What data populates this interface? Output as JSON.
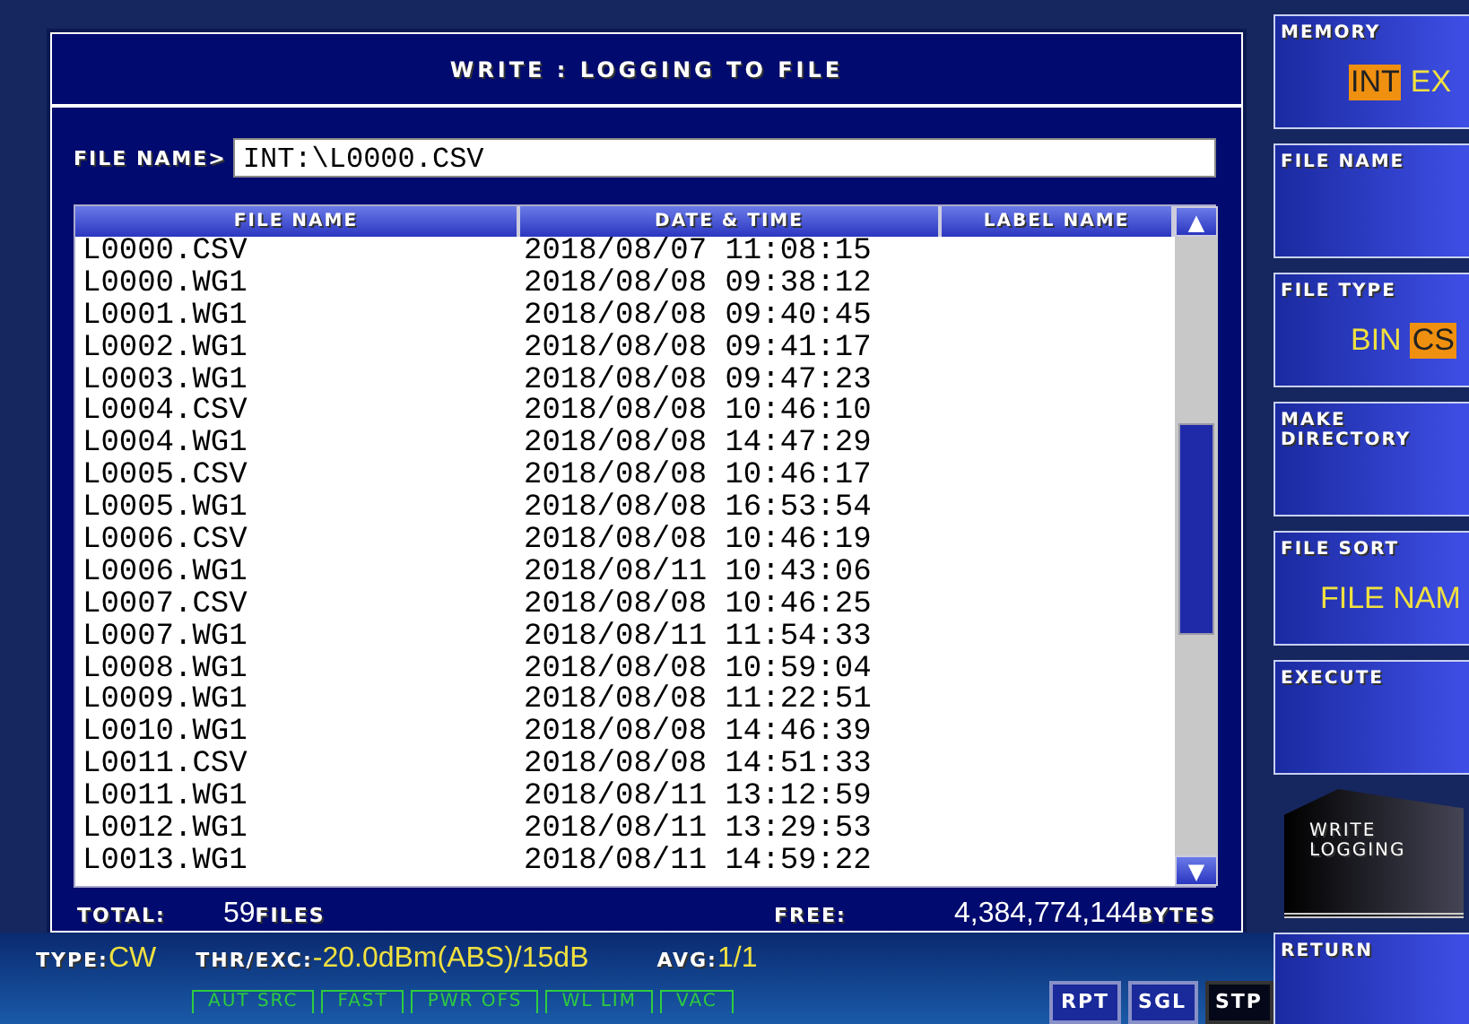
{
  "dialog": {
    "title": "WRITE : LOGGING TO FILE",
    "file_name_label": "FILE NAME>",
    "file_name_value": "INT:\\L0000.CSV",
    "table": {
      "columns": [
        "FILE NAME",
        "DATE & TIME",
        "LABEL NAME"
      ],
      "scroll_up": "▲",
      "scroll_down": "▼",
      "rows": [
        {
          "file_name": "L0000.CSV",
          "date_time": "2018/08/07 11:08:15"
        },
        {
          "file_name": "L0000.WG1",
          "date_time": "2018/08/08 09:38:12"
        },
        {
          "file_name": "L0001.WG1",
          "date_time": "2018/08/08 09:40:45"
        },
        {
          "file_name": "L0002.WG1",
          "date_time": "2018/08/08 09:41:17"
        },
        {
          "file_name": "L0003.WG1",
          "date_time": "2018/08/08 09:47:23"
        },
        {
          "file_name": "L0004.CSV",
          "date_time": "2018/08/08 10:46:10"
        },
        {
          "file_name": "L0004.WG1",
          "date_time": "2018/08/08 14:47:29"
        },
        {
          "file_name": "L0005.CSV",
          "date_time": "2018/08/08 10:46:17"
        },
        {
          "file_name": "L0005.WG1",
          "date_time": "2018/08/08 16:53:54"
        },
        {
          "file_name": "L0006.CSV",
          "date_time": "2018/08/08 10:46:19"
        },
        {
          "file_name": "L0006.WG1",
          "date_time": "2018/08/11 10:43:06"
        },
        {
          "file_name": "L0007.CSV",
          "date_time": "2018/08/08 10:46:25"
        },
        {
          "file_name": "L0007.WG1",
          "date_time": "2018/08/11 11:54:33"
        },
        {
          "file_name": "L0008.WG1",
          "date_time": "2018/08/08 10:59:04"
        },
        {
          "file_name": "L0009.WG1",
          "date_time": "2018/08/08 11:22:51"
        },
        {
          "file_name": "L0010.WG1",
          "date_time": "2018/08/08 14:46:39"
        },
        {
          "file_name": "L0011.CSV",
          "date_time": "2018/08/08 14:51:33"
        },
        {
          "file_name": "L0011.WG1",
          "date_time": "2018/08/11 13:12:59"
        },
        {
          "file_name": "L0012.WG1",
          "date_time": "2018/08/11 13:29:53"
        },
        {
          "file_name": "L0013.WG1",
          "date_time": "2018/08/11 14:59:22"
        }
      ]
    },
    "total_label": "TOTAL:",
    "total_count": "59",
    "total_unit": "FILES",
    "free_label": "FREE:",
    "free_value": "4,384,774,144",
    "free_unit": "BYTES"
  },
  "softkeys": [
    {
      "kind": "options",
      "label": "MEMORY",
      "options": [
        {
          "label": "INT",
          "selected": true
        },
        {
          "label": "EX",
          "selected": false
        }
      ]
    },
    {
      "kind": "plain",
      "label": "FILE NAME"
    },
    {
      "kind": "options",
      "label": "FILE TYPE",
      "options": [
        {
          "label": "BIN",
          "selected": false
        },
        {
          "label": "CS",
          "selected": true
        }
      ]
    },
    {
      "kind": "plain",
      "label": "MAKE DIRECTORY"
    },
    {
      "kind": "value",
      "label": "FILE SORT",
      "value": "FILE NAM"
    },
    {
      "kind": "plain",
      "label": "EXECUTE"
    },
    {
      "kind": "tab",
      "label": "WRITE LOGGING"
    },
    {
      "kind": "plain",
      "label": "RETURN"
    }
  ],
  "status": {
    "type_label": "TYPE:",
    "type_value": "CW",
    "thr_label": "THR/EXC:",
    "thr_value": "-20.0dBm(ABS)/15dB",
    "avg_label": "AVG:",
    "avg_value": "1/1",
    "indicators": [
      "AUT SRC",
      "FAST",
      "PWR OFS",
      "WL LIM",
      "VAC"
    ],
    "buttons": [
      {
        "label": "RPT",
        "selected": false
      },
      {
        "label": "SGL",
        "selected": false
      },
      {
        "label": "STP",
        "selected": true
      }
    ]
  }
}
